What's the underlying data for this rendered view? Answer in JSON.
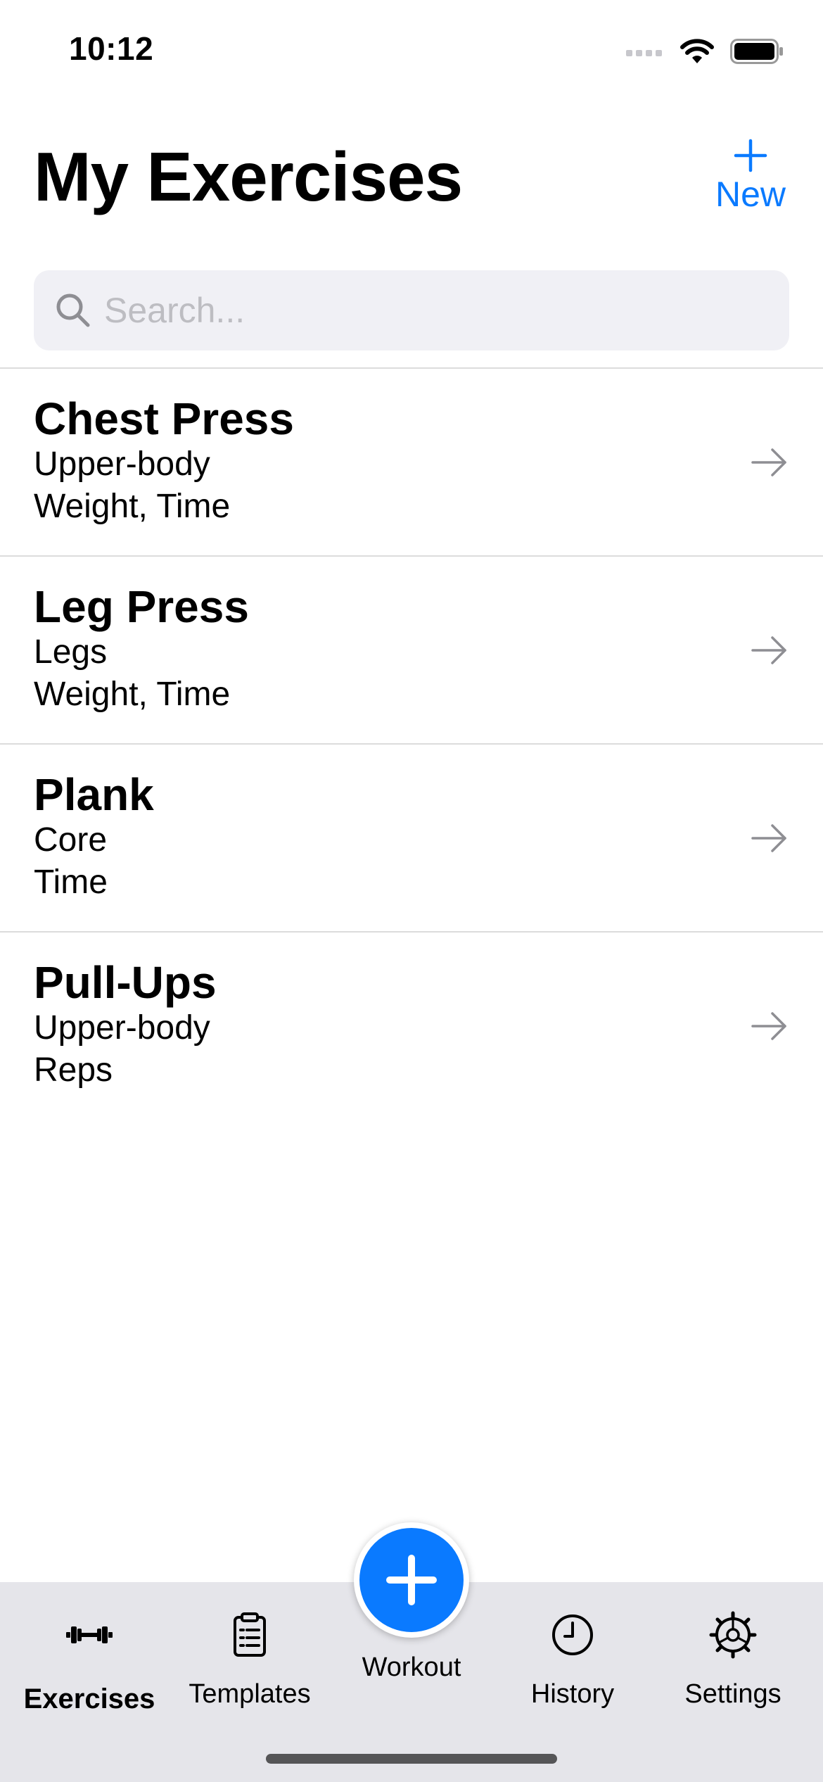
{
  "status_bar": {
    "time": "10:12"
  },
  "header": {
    "title": "My Exercises",
    "new_label": "New"
  },
  "search": {
    "placeholder": "Search...",
    "value": ""
  },
  "exercises": [
    {
      "name": "Chest Press",
      "category": "Upper-body",
      "metrics": "Weight, Time"
    },
    {
      "name": "Leg Press",
      "category": "Legs",
      "metrics": "Weight, Time"
    },
    {
      "name": "Plank",
      "category": "Core",
      "metrics": "Time"
    },
    {
      "name": "Pull-Ups",
      "category": "Upper-body",
      "metrics": "Reps"
    }
  ],
  "tab_bar": {
    "tabs": [
      {
        "label": "Exercises",
        "icon": "dumbbell-icon",
        "active": true
      },
      {
        "label": "Templates",
        "icon": "clipboard-icon",
        "active": false
      },
      {
        "label": "Workout",
        "icon": "plus-circle-icon",
        "active": false
      },
      {
        "label": "History",
        "icon": "clock-icon",
        "active": false
      },
      {
        "label": "Settings",
        "icon": "gear-icon",
        "active": false
      }
    ]
  },
  "colors": {
    "accent": "#0a7aff",
    "tab_bar_bg": "#e5e5ea",
    "search_bg": "#f0f0f5",
    "placeholder": "#bdbdc2"
  }
}
